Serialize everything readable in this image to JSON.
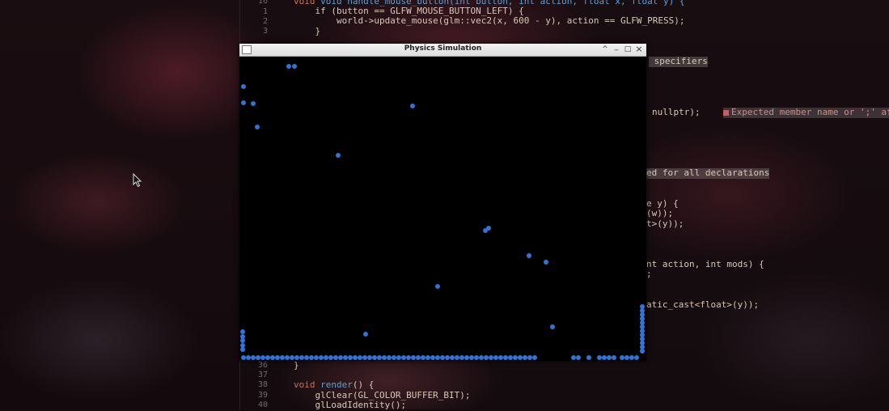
{
  "editor": {
    "lines": [
      {
        "n": "16",
        "text": "void handle_mouse_button(int button, int action, float x, float y) {"
      },
      {
        "n": "1",
        "text": "    if (button == GLFW_MOUSE_BUTTON_LEFT) {"
      },
      {
        "n": "2",
        "text": "        world->update_mouse(glm::vec2(x, 600 - y), action == GLFW_PRESS);"
      },
      {
        "n": "3",
        "text": "    }"
      },
      {
        "n": "36",
        "text": "}"
      },
      {
        "n": "37",
        "text": ""
      },
      {
        "n": "38",
        "text": "void render() {"
      },
      {
        "n": "39",
        "text": "    glClear(GL_COLOR_BUFFER_BIT);"
      },
      {
        "n": "40",
        "text": "    glLoadIdentity();"
      }
    ],
    "fragments": {
      "specifiers": " specifiers",
      "nullptr": "nullptr);",
      "error": "Expected member name or ';' af",
      "declarations": "ed for all declarations",
      "frag_y": "e y) {",
      "frag_w": "(w));",
      "frag_ty": "t>(y));",
      "frag_action": "nt action, int mods) {",
      "frag_semi": ";",
      "frag_cast": "atic_cast<float>(y));"
    }
  },
  "window": {
    "title": "Physics Simulation",
    "buttons": {
      "up": "^",
      "minimize": "_",
      "maximize": "□",
      "close": "×"
    }
  },
  "simulation": {
    "ball_color": "#2f74d6",
    "ball_count": 143
  },
  "icons": {
    "cursor": "mouse-pointer-icon",
    "app": "window-app-icon"
  }
}
